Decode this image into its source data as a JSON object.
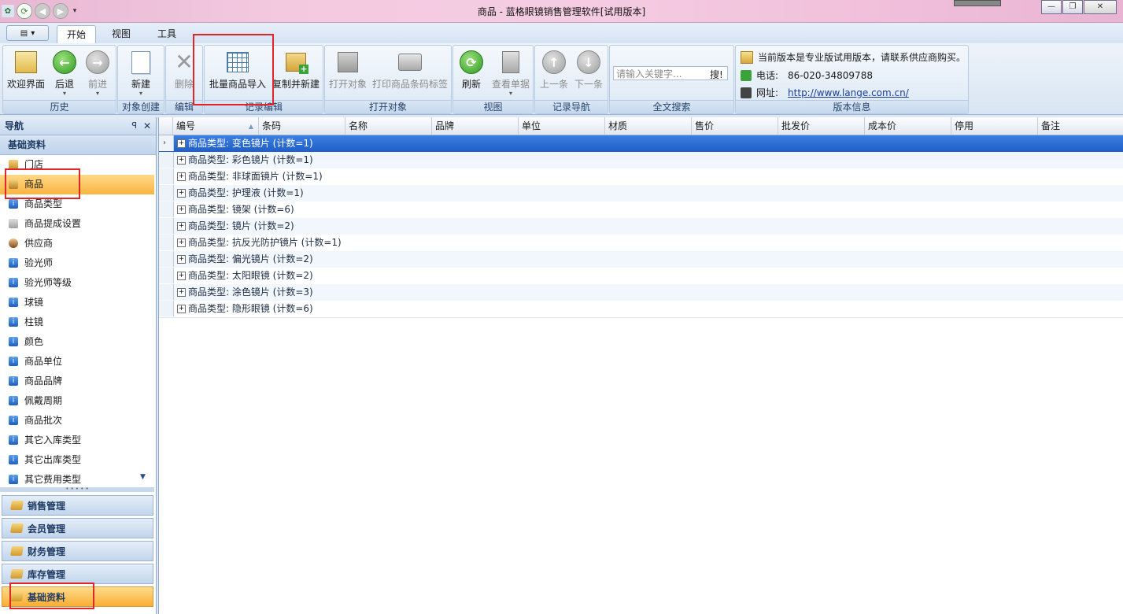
{
  "window": {
    "title": "商品 - 蓝格眼镜销售管理软件[试用版本]",
    "controls": {
      "minimize": "—",
      "restore": "❐",
      "close": "✕"
    }
  },
  "quick_access": {
    "app_icon": "app-icon",
    "refresh": "⟳",
    "back": "◀",
    "forward": "▶",
    "dropdown": "▾"
  },
  "ribbon_tabs": [
    {
      "label": "开始",
      "active": true
    },
    {
      "label": "视图",
      "active": false
    },
    {
      "label": "工具",
      "active": false
    }
  ],
  "ribbon": {
    "groups": {
      "history": "历史",
      "create": "对象创建",
      "edit": "编辑",
      "record_edit": "记录编辑",
      "open": "打开对象",
      "view": "视图",
      "nav": "记录导航",
      "search": "全文搜索",
      "version": "版本信息"
    },
    "buttons": {
      "welcome": "欢迎界面",
      "back": "后退",
      "forward": "前进",
      "new": "新建",
      "delete": "删除",
      "batch_import": "批量商品导入",
      "copy_new": "复制并新建",
      "open_object": "打开对象",
      "print_barcode": "打印商品条码标签",
      "refresh": "刷新",
      "view_doc": "查看单据",
      "prev": "上一条",
      "next": "下一条"
    },
    "search": {
      "placeholder": "请输入关键字...",
      "button": "搜!"
    },
    "version_info": {
      "notice": "当前版本是专业版试用版本，请联系供应商购买。",
      "phone_label": "电话:",
      "phone": "86-020-34809788",
      "site_label": "网址:",
      "site": "http://www.lange.com.cn/"
    }
  },
  "nav": {
    "header": "导航",
    "pin": "ꟼ",
    "close": "✕",
    "section": "基础资料",
    "items": [
      {
        "label": "门店",
        "icon": "store-icon"
      },
      {
        "label": "商品",
        "icon": "product-box-icon",
        "selected": true
      },
      {
        "label": "商品类型",
        "icon": "info-icon"
      },
      {
        "label": "商品提成设置",
        "icon": "commission-icon"
      },
      {
        "label": "供应商",
        "icon": "supplier-icon"
      },
      {
        "label": "验光师",
        "icon": "info-icon"
      },
      {
        "label": "验光师等级",
        "icon": "info-icon"
      },
      {
        "label": "球镜",
        "icon": "info-icon"
      },
      {
        "label": "柱镜",
        "icon": "info-icon"
      },
      {
        "label": "颜色",
        "icon": "info-icon"
      },
      {
        "label": "商品单位",
        "icon": "info-icon"
      },
      {
        "label": "商品品牌",
        "icon": "info-icon"
      },
      {
        "label": "佩戴周期",
        "icon": "info-icon"
      },
      {
        "label": "商品批次",
        "icon": "info-icon"
      },
      {
        "label": "其它入库类型",
        "icon": "info-icon"
      },
      {
        "label": "其它出库类型",
        "icon": "info-icon"
      },
      {
        "label": "其它费用类型",
        "icon": "info-icon"
      }
    ],
    "panes": [
      {
        "label": "销售管理",
        "active": false
      },
      {
        "label": "会员管理",
        "active": false
      },
      {
        "label": "财务管理",
        "active": false
      },
      {
        "label": "库存管理",
        "active": false
      },
      {
        "label": "基础资料",
        "active": true
      }
    ]
  },
  "grid": {
    "columns": [
      "编号",
      "条码",
      "名称",
      "品牌",
      "单位",
      "材质",
      "售价",
      "批发价",
      "成本价",
      "停用",
      "备注"
    ],
    "groups": [
      "商品类型: 变色镜片 (计数=1)",
      "商品类型: 彩色镜片 (计数=1)",
      "商品类型: 非球面镜片 (计数=1)",
      "商品类型: 护理液 (计数=1)",
      "商品类型: 镜架 (计数=6)",
      "商品类型: 镜片 (计数=2)",
      "商品类型: 抗反光防护镜片 (计数=1)",
      "商品类型: 偏光镜片 (计数=2)",
      "商品类型: 太阳眼镜 (计数=2)",
      "商品类型: 涂色镜片 (计数=3)",
      "商品类型: 隐形眼镜 (计数=6)"
    ],
    "selected_index": 0
  },
  "colors": {
    "highlight_red": "#e0252b",
    "selection_blue": "#1f5fc9",
    "nav_selected": "#fbb43e"
  }
}
